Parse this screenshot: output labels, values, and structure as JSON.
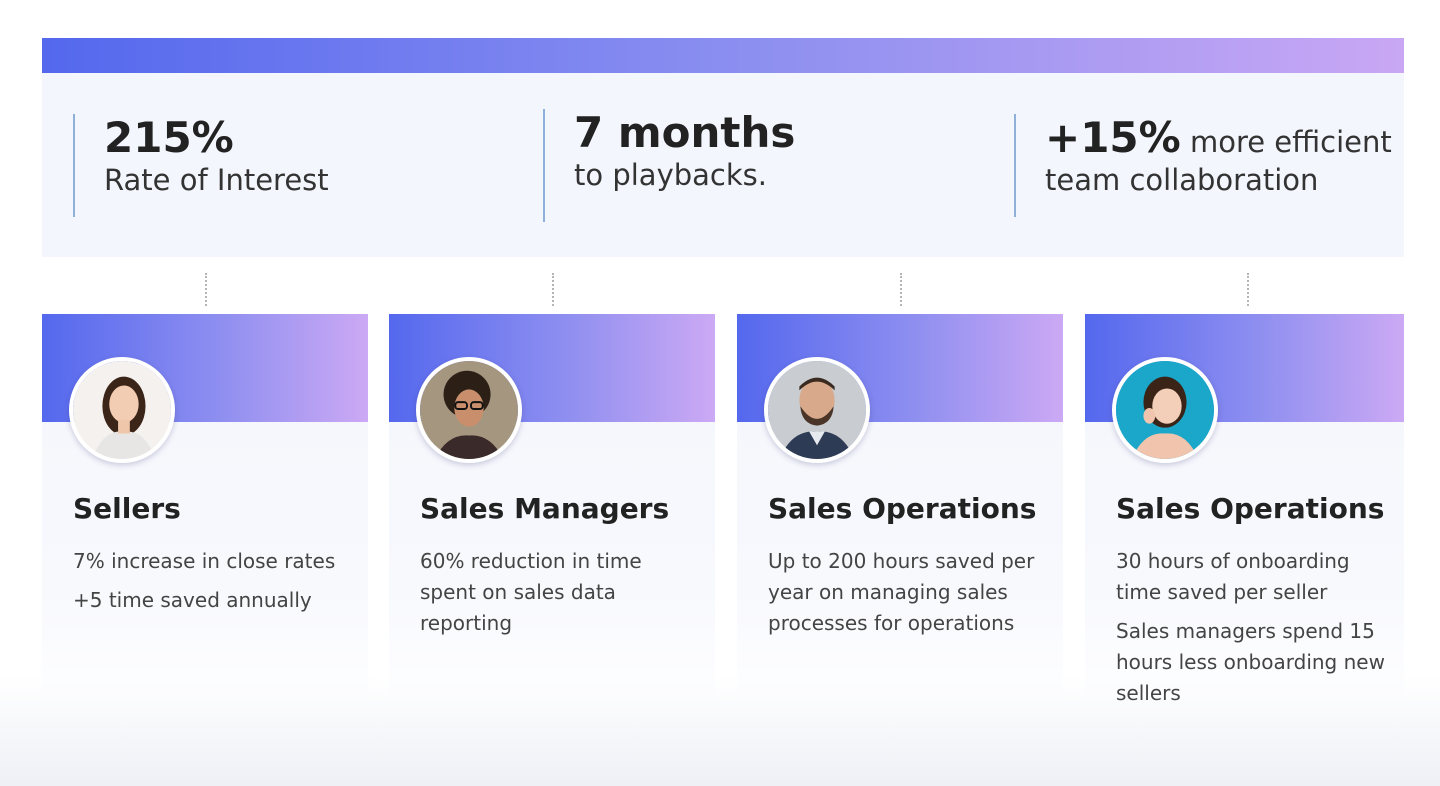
{
  "stats": [
    {
      "value": "215%",
      "label": "Rate of Interest"
    },
    {
      "value": "7 months",
      "label": "to playbacks."
    },
    {
      "value": "+15%",
      "inline": " more efficient",
      "label": "team collaboration"
    }
  ],
  "cards": [
    {
      "title": "Sellers",
      "lines": [
        "7% increase in close rates",
        "+5 time saved annually"
      ]
    },
    {
      "title": "Sales Managers",
      "lines": [
        "60% reduction in time spent on sales data reporting"
      ]
    },
    {
      "title": "Sales Operations",
      "lines": [
        "Up to 200 hours saved per year on managing sales processes for operations"
      ]
    },
    {
      "title": "Sales Operations",
      "lines": [
        "30 hours of onboarding time saved per seller",
        "Sales managers spend 15 hours less onboarding new sellers"
      ]
    }
  ],
  "colors": {
    "gradient_start": "#5468ee",
    "gradient_end": "#c9a7f4",
    "panel_bg": "#f3f6fd",
    "stat_divider": "#8fb1d9"
  }
}
